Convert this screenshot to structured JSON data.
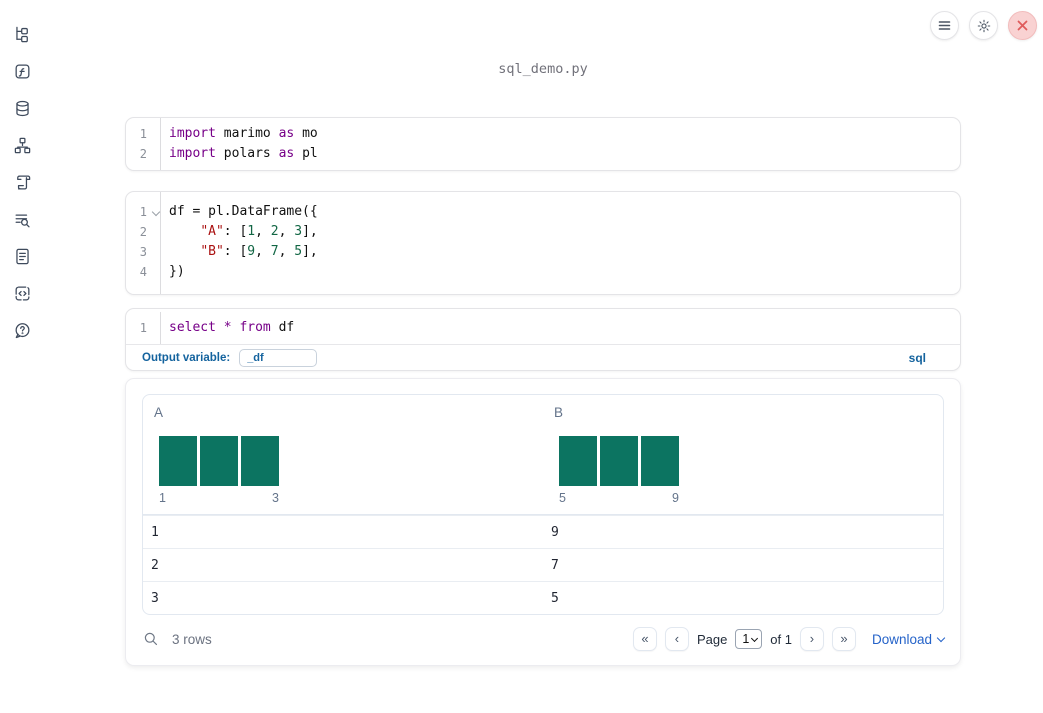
{
  "window": {
    "filename": "sql_demo.py"
  },
  "colors": {
    "keyword": "#770088",
    "number": "#116644",
    "string": "#aa1111",
    "bar_teal": "#0c7461",
    "label_blue": "#14639e",
    "link_blue": "#2563c9",
    "close_red": "#df5b5b"
  },
  "sidebar": {
    "items": [
      {
        "icon": "file-tree-icon"
      },
      {
        "icon": "function-icon"
      },
      {
        "icon": "database-icon"
      },
      {
        "icon": "dependency-graph-icon"
      },
      {
        "icon": "scroll-icon"
      },
      {
        "icon": "search-list-icon"
      },
      {
        "icon": "document-icon"
      },
      {
        "icon": "snippets-icon"
      },
      {
        "icon": "help-icon"
      }
    ]
  },
  "topbar": {
    "menu_icon": "hamburger-menu-icon",
    "settings_icon": "gear-icon",
    "close_icon": "close-x-icon"
  },
  "cells": {
    "imports": {
      "nums": [
        "1",
        "2"
      ],
      "lines": [
        {
          "kw1": "import",
          "p1": " marimo ",
          "kw2": "as",
          "p2": " mo"
        },
        {
          "kw1": "import",
          "p1": " polars ",
          "kw2": "as",
          "p2": " pl"
        }
      ]
    },
    "dataframe": {
      "nums": [
        "1",
        "2",
        "3",
        "4"
      ],
      "lines": [
        {
          "p1": "df = pl.DataFrame({"
        },
        {
          "p1": "    ",
          "s1": "\"A\"",
          "p2": ": [",
          "n1": "1",
          "p3": ", ",
          "n2": "2",
          "p4": ", ",
          "n3": "3",
          "p5": "],"
        },
        {
          "p1": "    ",
          "s1": "\"B\"",
          "p2": ": [",
          "n1": "9",
          "p3": ", ",
          "n2": "7",
          "p4": ", ",
          "n3": "5",
          "p5": "],"
        },
        {
          "p1": "})"
        }
      ]
    },
    "sql": {
      "num": "1",
      "line": {
        "kw1": "select",
        "p1": " ",
        "op": "*",
        "p2": " ",
        "kw2": "from",
        "p3": " df"
      },
      "output_variable_label": "Output variable:",
      "output_variable_value": "_df",
      "language_badge": "sql"
    }
  },
  "table": {
    "columns": [
      {
        "name": "A",
        "histogram": {
          "bars": [
            1,
            1,
            1
          ],
          "min_label": "1",
          "max_label": "3"
        }
      },
      {
        "name": "B",
        "histogram": {
          "bars": [
            1,
            1,
            1
          ],
          "min_label": "5",
          "max_label": "9"
        }
      }
    ],
    "rows": [
      [
        "1",
        "9"
      ],
      [
        "2",
        "7"
      ],
      [
        "3",
        "5"
      ]
    ],
    "row_count": "3 rows",
    "pagination": {
      "first": "«",
      "prev": "‹",
      "page_label": "Page",
      "page_value": "1",
      "of_label": "of 1",
      "next": "›",
      "last": "»"
    },
    "download_label": "Download"
  }
}
